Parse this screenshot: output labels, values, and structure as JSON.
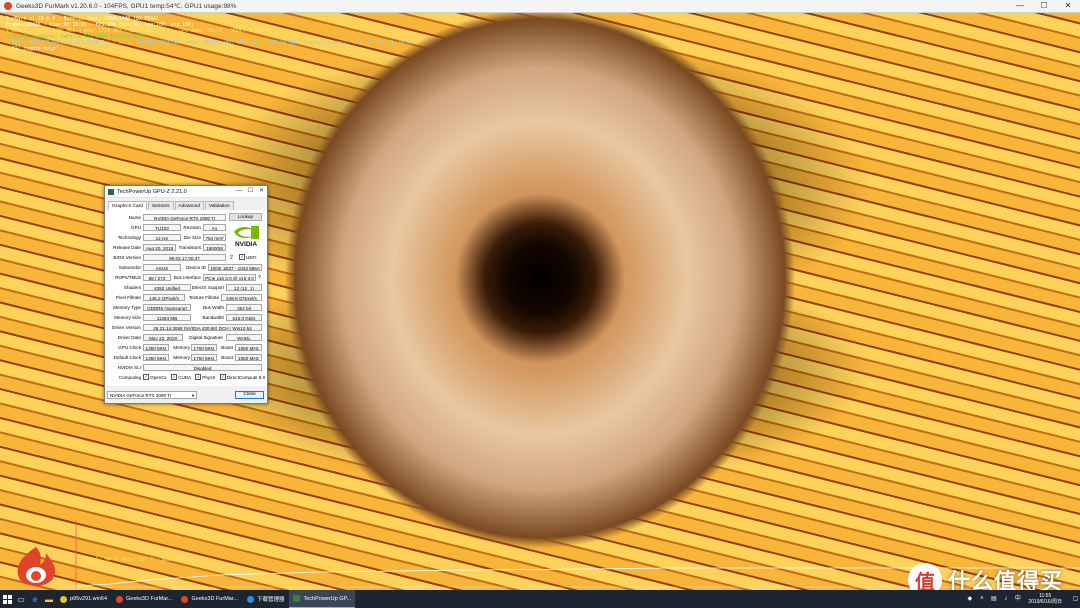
{
  "furmark": {
    "title": "Geeks3D FurMark v1.20.6.0 - 104FPS, GPU1 temp:54℃, GPU1 usage:98%",
    "overlay": [
      {
        "text": "FurMark v1.20.6.0 - Burn-in test, 2560x1440 (8X MSAA)",
        "color": "white"
      },
      {
        "text": "Frames:80436 - time:00:18:01 - FPS:104 (min:51, max:160, avg:106)",
        "color": "white"
      },
      {
        "text": "[ GPU-Z ] core: 1485 MHz - mem: 1750 MHz - GPU load: 98 % - GPU temp: 54 °C - VDDC: 0.768 V",
        "color": "yellow"
      },
      {
        "text": "> OpenGL renderer: GeForce RTX 2080 Ti/PCIe/SSE2",
        "color": "green"
      },
      {
        "text": "> GPU 1 (NVIDIA GeForce RTX 2080 Ti) - core: 1485MHz/54°C/98%, mem: 7000MHz/8%, GPU power: 100.2% TDP, limits:[power:1, temp:0, volt:0, OV:0]",
        "color": "cyan"
      },
      {
        "text": "- F1: toggle help",
        "color": "white"
      }
    ],
    "graph_label": "GPU 1: 54° C (min: 35° C - max: 54° C)",
    "window_controls": {
      "minimize": "—",
      "maximize": "☐",
      "close": "✕"
    }
  },
  "watermark": {
    "badge": "值",
    "text": "什么值得买"
  },
  "gpuz": {
    "title": "TechPowerUp GPU-Z 2.21.0",
    "controls": {
      "minimize": "—",
      "maximize": "☐",
      "close": "✕"
    },
    "tabs": [
      "Graphics Card",
      "Sensors",
      "Advanced",
      "Validation"
    ],
    "rows": {
      "name": {
        "label": "Name",
        "value": "NVIDIA GeForce RTX 2080 Ti",
        "button": "Lookup"
      },
      "gpu": {
        "label": "GPU",
        "value": "TU102",
        "sublabel": "Revision",
        "subvalue": "A1"
      },
      "technology": {
        "label": "Technology",
        "value": "12 nm",
        "sublabel": "Die Size",
        "subvalue": "754 mm²"
      },
      "release": {
        "label": "Release Date",
        "value": "Aug 20, 2018",
        "sublabel": "Transistors",
        "subvalue": "18600M"
      },
      "bios": {
        "label": "BIOS Version",
        "value": "90.02.17.00.47",
        "uefi": "UEFI"
      },
      "subvendor": {
        "label": "Subvendor",
        "value": "ASUS",
        "sublabel": "Device ID",
        "subvalue": "10DE 1E07 - 1043 866A"
      },
      "rops": {
        "label": "ROPs/TMUs",
        "value": "88 / 272",
        "sublabel": "Bus Interface",
        "subvalue": "PCIe x16 3.0 @ x16 3.0",
        "help": "?"
      },
      "shaders": {
        "label": "Shaders",
        "value": "4352 Unified",
        "sublabel": "DirectX Support",
        "subvalue": "12 (12_1)"
      },
      "pixel": {
        "label": "Pixel Fillrate",
        "value": "145.2 GPixel/s",
        "sublabel": "Texture Fillrate",
        "subvalue": "448.8 GTexel/s"
      },
      "memtype": {
        "label": "Memory Type",
        "value": "GDDR6 (Samsung)",
        "sublabel": "Bus Width",
        "subvalue": "352 bit"
      },
      "memsize": {
        "label": "Memory Size",
        "value": "11264 MB",
        "sublabel": "Bandwidth",
        "subvalue": "616.0 GB/s"
      },
      "driver": {
        "label": "Driver Version",
        "value": "26.21.14.3086 (NVIDIA 430.86) DCH / Win10 64"
      },
      "driverdate": {
        "label": "Driver Date",
        "value": "May 22, 2019",
        "sublabel": "Digital Signature",
        "subvalue": "WHQL"
      },
      "gpuclock": {
        "label": "GPU Clock",
        "value": "1350 MHz",
        "memlabel": "Memory",
        "memvalue": "1750 MHz",
        "boostlabel": "Boost",
        "boostvalue": "1650 MHz"
      },
      "defclock": {
        "label": "Default Clock",
        "value": "1350 MHz",
        "memlabel": "Memory",
        "memvalue": "1750 MHz",
        "boostlabel": "Boost",
        "boostvalue": "1650 MHz"
      },
      "sli": {
        "label": "NVIDIA SLI",
        "value": "Disabled"
      },
      "computing": {
        "label": "Computing",
        "items": [
          "OpenCL",
          "CUDA",
          "PhysX",
          "DirectCompute 5.0"
        ]
      }
    },
    "vendor_logo": "NVIDIA",
    "device_select": "NVIDIA GeForce RTX 2080 Ti",
    "close_button": "Close"
  },
  "taskbar": {
    "apps": [
      {
        "label": "p95v291.win64",
        "active": false,
        "color": "#e8c33a"
      },
      {
        "label": "Geeks3D FurMar...",
        "active": false,
        "color": "#e0442a"
      },
      {
        "label": "Geeks3D FurMar...",
        "active": false,
        "color": "#e0442a"
      },
      {
        "label": "下载管理器",
        "active": false,
        "color": "#2f8fdc"
      },
      {
        "label": "TechPowerUp GP...",
        "active": true,
        "color": "#3f7a3f"
      }
    ],
    "clock_time": "11:55",
    "clock_date": "2019/6/16/周日"
  }
}
